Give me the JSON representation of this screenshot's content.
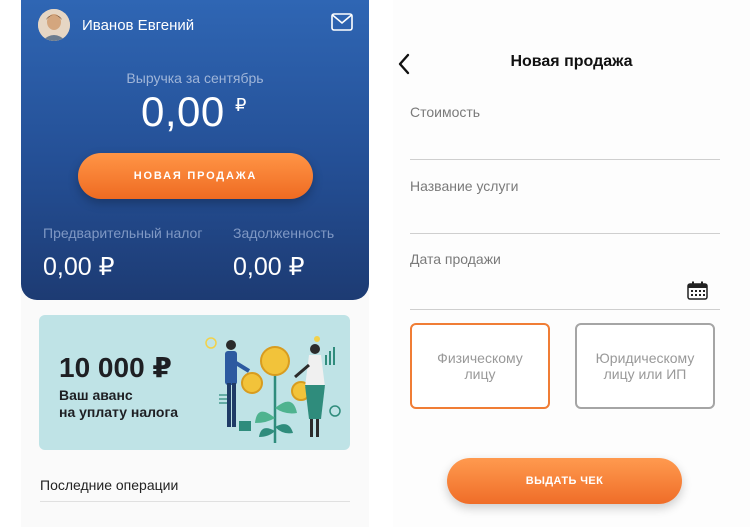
{
  "home": {
    "user_name": "Иванов Евгений",
    "icons": {
      "avatar": "user-avatar",
      "mail": "envelope-icon"
    },
    "revenue_label": "Выручка за сентябрь",
    "revenue_amount": "0,00",
    "revenue_currency": "₽",
    "new_sale_button": "НОВАЯ ПРОДАЖА",
    "tax_label": "Предварительный налог",
    "tax_value": "0,00 ₽",
    "debt_label": "Задолженность",
    "debt_value": "0,00 ₽",
    "promo": {
      "amount": "10 000 ₽",
      "line1": "Ваш аванс",
      "line2": "на уплату налога"
    },
    "operations_title": "Последние операции"
  },
  "sale_form": {
    "title": "Новая продажа",
    "fields": {
      "cost": "Стоимость",
      "service_name": "Название услуги",
      "sale_date": "Дата продажи"
    },
    "client_type": {
      "individual": "Физическому лицу",
      "legal": "Юридическому лицу или ИП",
      "selected": "individual"
    },
    "submit_button": "ВЫДАТЬ ЧЕК"
  },
  "colors": {
    "accent_orange": "#f07d35",
    "hero_blue_top": "#2f66b4",
    "hero_blue_bottom": "#1d3b73",
    "promo_bg": "#bfe3e6"
  }
}
